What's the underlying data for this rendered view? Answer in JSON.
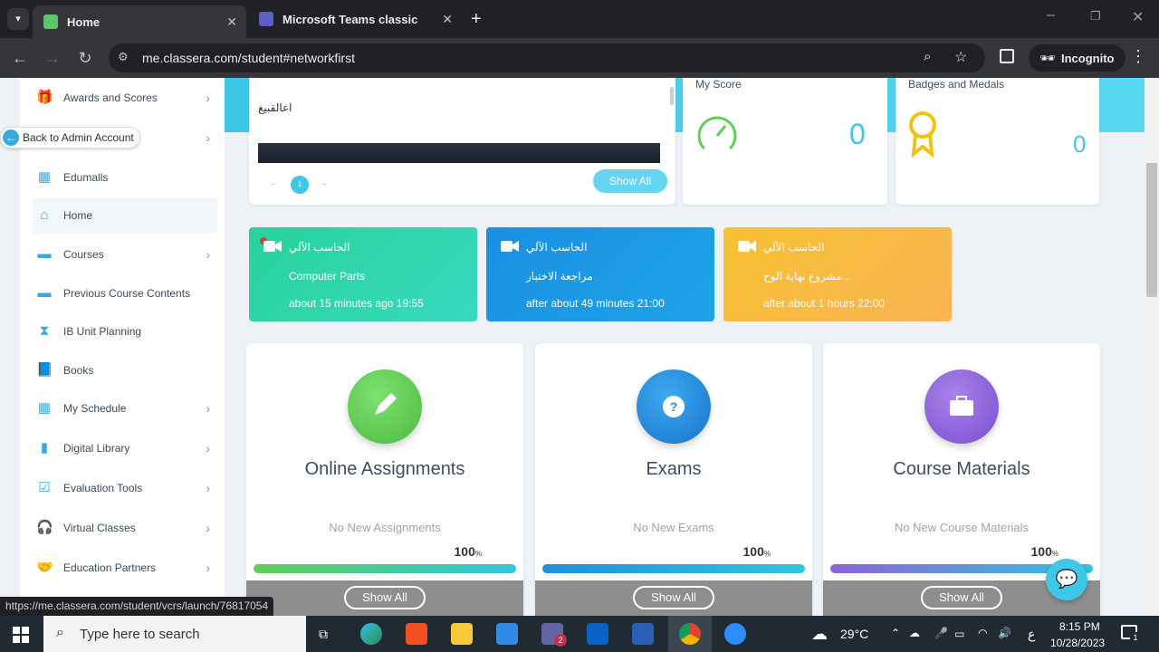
{
  "browser": {
    "tabs": [
      {
        "title": "Home",
        "active": true
      },
      {
        "title": "Microsoft Teams classic",
        "active": false
      }
    ],
    "new_tab_symbol": "+",
    "url": "me.classera.com/student#networkfirst",
    "incognito_label": "Incognito",
    "status_url": "https://me.classera.com/student/vcrs/launch/76817054"
  },
  "sidebar": {
    "back_admin": "Back to Admin Account",
    "items": [
      {
        "label": "Awards and Scores",
        "icon": "award-icon",
        "chevron": true
      },
      {
        "label": "",
        "icon": "",
        "chevron": true
      },
      {
        "label": "Edumalls",
        "icon": "grid-icon",
        "chevron": false
      },
      {
        "label": "Home",
        "icon": "home-icon",
        "chevron": false
      },
      {
        "label": "Courses",
        "icon": "briefcase-icon",
        "chevron": true
      },
      {
        "label": "Previous Course Contents",
        "icon": "briefcase-icon",
        "chevron": false
      },
      {
        "label": "IB Unit Planning",
        "icon": "hourglass-icon",
        "chevron": false
      },
      {
        "label": "Books",
        "icon": "book-icon",
        "chevron": false
      },
      {
        "label": "My Schedule",
        "icon": "calendar-icon",
        "chevron": true
      },
      {
        "label": "Digital Library",
        "icon": "library-icon",
        "chevron": true
      },
      {
        "label": "Evaluation Tools",
        "icon": "checkbox-icon",
        "chevron": true
      },
      {
        "label": "Virtual Classes",
        "icon": "headphones-icon",
        "chevron": true
      },
      {
        "label": "Education Partners",
        "icon": "handshake-icon",
        "chevron": true
      }
    ]
  },
  "announcement": {
    "text": "اعالقبيغ",
    "page": "1",
    "show_all": "Show All"
  },
  "score": {
    "title": "My Score",
    "value": "0"
  },
  "badges": {
    "title": "Badges and Medals",
    "value": "0"
  },
  "events": [
    {
      "course": "الحاسب الآلي",
      "title": "Computer Parts",
      "time": "about 15 minutes ago  19:55",
      "color": "#27d39a",
      "live": true
    },
    {
      "course": "الحاسب الآلي",
      "title": "مراجعة الاختبار",
      "time": "after about 49 minutes  21:00",
      "color": "#1a8fe3",
      "live": false
    },
    {
      "course": "الحاسب الآلي",
      "title": "مشروع نهاية الوح...",
      "time": "after about 1 hours  22:00",
      "color": "#f7c232",
      "live": false
    }
  ],
  "features": [
    {
      "title": "Online Assignments",
      "subtitle": "No New Assignments",
      "percent": "100",
      "percent_sign": "%",
      "button": "Show All",
      "icon": "pencil-icon",
      "color": "#5fcf55"
    },
    {
      "title": "Exams",
      "subtitle": "No New Exams",
      "percent": "100",
      "percent_sign": "%",
      "button": "Show All",
      "icon": "question-icon",
      "color": "#1f8fe0"
    },
    {
      "title": "Course Materials",
      "subtitle": "No New Course Materials",
      "percent": "100",
      "percent_sign": "%",
      "button": "Show All",
      "icon": "briefcase-icon",
      "color": "#8f62d9"
    }
  ],
  "taskbar": {
    "search_placeholder": "Type here to search",
    "weather": "29°C",
    "lang": "ع",
    "time": "8:15 PM",
    "date": "10/28/2023",
    "notif_count": "1",
    "teams_badge": "2"
  }
}
